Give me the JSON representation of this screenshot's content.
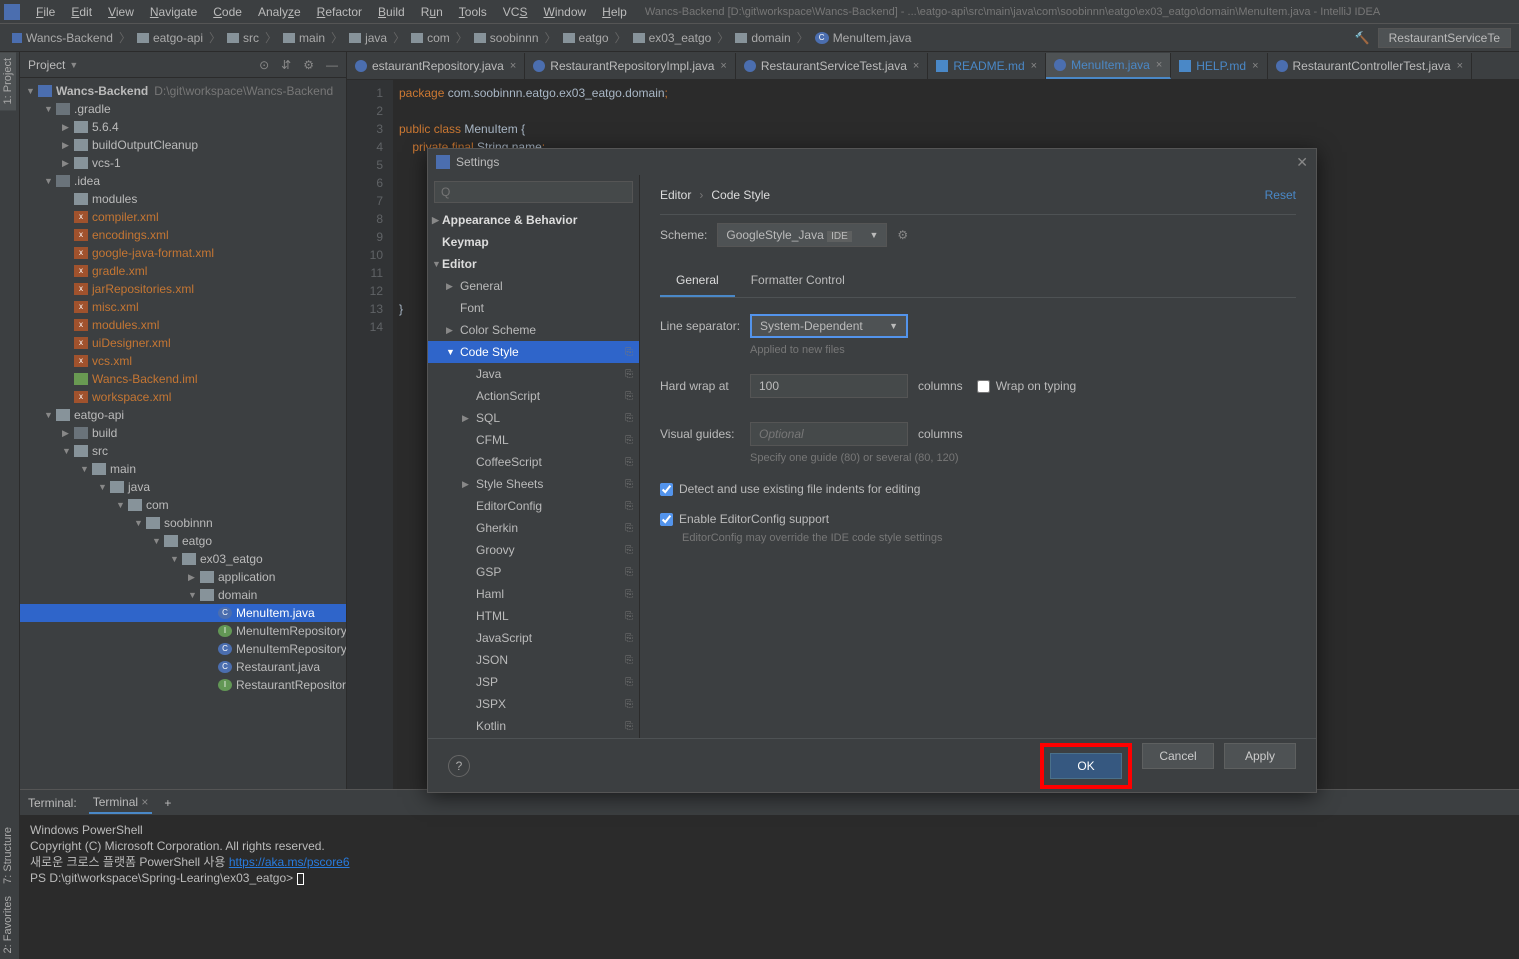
{
  "menubar": {
    "items": [
      "File",
      "Edit",
      "View",
      "Navigate",
      "Code",
      "Analyze",
      "Refactor",
      "Build",
      "Run",
      "Tools",
      "VCS",
      "Window",
      "Help"
    ],
    "title_path": "Wancs-Backend [D:\\git\\workspace\\Wancs-Backend] - ...\\eatgo-api\\src\\main\\java\\com\\soobinnn\\eatgo\\ex03_eatgo\\domain\\MenuItem.java - IntelliJ IDEA"
  },
  "breadcrumb": {
    "items": [
      "Wancs-Backend",
      "eatgo-api",
      "src",
      "main",
      "java",
      "com",
      "soobinnn",
      "eatgo",
      "ex03_eatgo",
      "domain",
      "MenuItem.java"
    ],
    "run_config": "RestaurantServiceTe"
  },
  "project_panel": {
    "title": "Project",
    "root_name": "Wancs-Backend",
    "root_path": "D:\\git\\workspace\\Wancs-Backend",
    "gradle": ".gradle",
    "gradle_v": "5.6.4",
    "buildOutput": "buildOutputCleanup",
    "vcs": "vcs-1",
    "idea": ".idea",
    "idea_files": [
      "modules",
      "compiler.xml",
      "encodings.xml",
      "google-java-format.xml",
      "gradle.xml",
      "jarRepositories.xml",
      "misc.xml",
      "modules.xml",
      "uiDesigner.xml",
      "vcs.xml",
      "Wancs-Backend.iml",
      "workspace.xml"
    ],
    "eatgo_api": "eatgo-api",
    "build": "build",
    "src": "src",
    "main": "main",
    "java_dir": "java",
    "com": "com",
    "soobinnn": "soobinnn",
    "eatgo": "eatgo",
    "ex03": "ex03_eatgo",
    "application": "application",
    "domain": "domain",
    "domain_files": [
      "MenuItem.java",
      "MenuItemRepository.java",
      "MenuItemRepositoryImpl.jav",
      "Restaurant.java",
      "RestaurantRepository.java"
    ]
  },
  "editor": {
    "tabs": [
      {
        "label": "estaurantRepository.java",
        "icon": "java"
      },
      {
        "label": "RestaurantRepositoryImpl.java",
        "icon": "java"
      },
      {
        "label": "RestaurantServiceTest.java",
        "icon": "java"
      },
      {
        "label": "README.md",
        "icon": "md"
      },
      {
        "label": "MenuItem.java",
        "icon": "java",
        "active": true
      },
      {
        "label": "HELP.md",
        "icon": "md"
      },
      {
        "label": "RestaurantControllerTest.java",
        "icon": "java"
      }
    ],
    "lines": 14,
    "code": {
      "l1_kw": "package ",
      "l1_rest": "com.soobinnn.eatgo.ex03_eatgo.domain",
      "l3_kw": "public class ",
      "l3_name": "MenuItem {",
      "l4_kw": "    private final ",
      "l4_type": "String ",
      "l4_name": "name",
      "l13": "}"
    }
  },
  "terminal": {
    "label": "Terminal:",
    "tab": "Terminal",
    "lines": {
      "l1": "Windows PowerShell",
      "l2": "Copyright (C) Microsoft Corporation. All rights reserved.",
      "l3_pre": "새로운 크로스 플랫폼 PowerShell 사용 ",
      "l3_link": "https://aka.ms/pscore6",
      "l4": "PS D:\\git\\workspace\\Spring-Learing\\ex03_eatgo> "
    }
  },
  "side_stripe": {
    "project": "1: Project",
    "structure": "7: Structure",
    "favorites": "2: Favorites"
  },
  "settings": {
    "title": "Settings",
    "search_placeholder": "Q",
    "categories": {
      "appearance": "Appearance & Behavior",
      "keymap": "Keymap",
      "editor": "Editor",
      "general": "General",
      "font": "Font",
      "color_scheme": "Color Scheme",
      "code_style": "Code Style",
      "langs": [
        "Java",
        "ActionScript",
        "SQL",
        "CFML",
        "CoffeeScript",
        "Style Sheets",
        "EditorConfig",
        "Gherkin",
        "Groovy",
        "GSP",
        "Haml",
        "HTML",
        "JavaScript",
        "JSON",
        "JSP",
        "JSPX",
        "Kotlin"
      ]
    },
    "crumb": {
      "editor": "Editor",
      "code_style": "Code Style"
    },
    "reset": "Reset",
    "scheme_label": "Scheme:",
    "scheme_value": "GoogleStyle_Java",
    "scheme_tag": "IDE",
    "subtabs": {
      "general": "General",
      "formatter": "Formatter Control"
    },
    "line_sep_label": "Line separator:",
    "line_sep_value": "System-Dependent",
    "line_sep_hint": "Applied to new files",
    "hard_wrap_label": "Hard wrap at",
    "hard_wrap_value": "100",
    "columns": "columns",
    "wrap_typing": "Wrap on typing",
    "visual_guides_label": "Visual guides:",
    "visual_guides_placeholder": "Optional",
    "visual_guides_hint": "Specify one guide (80) or several (80, 120)",
    "detect_indents": "Detect and use existing file indents for editing",
    "enable_editorconfig": "Enable EditorConfig support",
    "editorconfig_hint": "EditorConfig may override the IDE code style settings",
    "buttons": {
      "ok": "OK",
      "cancel": "Cancel",
      "apply": "Apply"
    }
  }
}
